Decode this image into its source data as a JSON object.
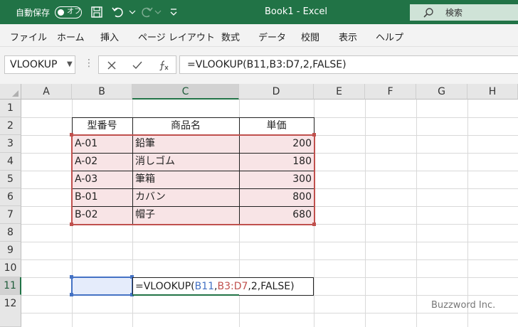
{
  "titlebar": {
    "autosave_label": "自動保存",
    "toggle_label": "オフ",
    "doc_title": "Book1 - Excel",
    "search_label": "検索",
    "brand_color": "#217346"
  },
  "menu": [
    "ファイル",
    "ホーム",
    "挿入",
    "ページ レイアウト",
    "数式",
    "データ",
    "校閲",
    "表示",
    "ヘルプ"
  ],
  "formula_bar": {
    "name_box": "VLOOKUP",
    "formula": "=VLOOKUP(B11,B3:D7,2,FALSE)"
  },
  "columns": [
    "A",
    "B",
    "C",
    "D",
    "E",
    "F",
    "G",
    "H"
  ],
  "rows": [
    "1",
    "2",
    "3",
    "4",
    "5",
    "6",
    "7",
    "8",
    "9",
    "10",
    "11",
    "12"
  ],
  "table": {
    "headers": [
      "型番号",
      "商品名",
      "単価"
    ],
    "rows": [
      [
        "A-01",
        "鉛筆",
        "200"
      ],
      [
        "A-02",
        "消しゴム",
        "180"
      ],
      [
        "A-03",
        "筆箱",
        "300"
      ],
      [
        "B-01",
        "カバン",
        "800"
      ],
      [
        "B-02",
        "帽子",
        "680"
      ]
    ]
  },
  "editing_cell": {
    "func": "=VLOOKUP(",
    "ref1": "B11",
    "comma1": ",",
    "ref2": "B3:D7",
    "rest": ",2,FALSE)",
    "ref1_color": "#4472c4",
    "ref2_color": "#c0504d"
  },
  "watermark": "Buzzword Inc."
}
